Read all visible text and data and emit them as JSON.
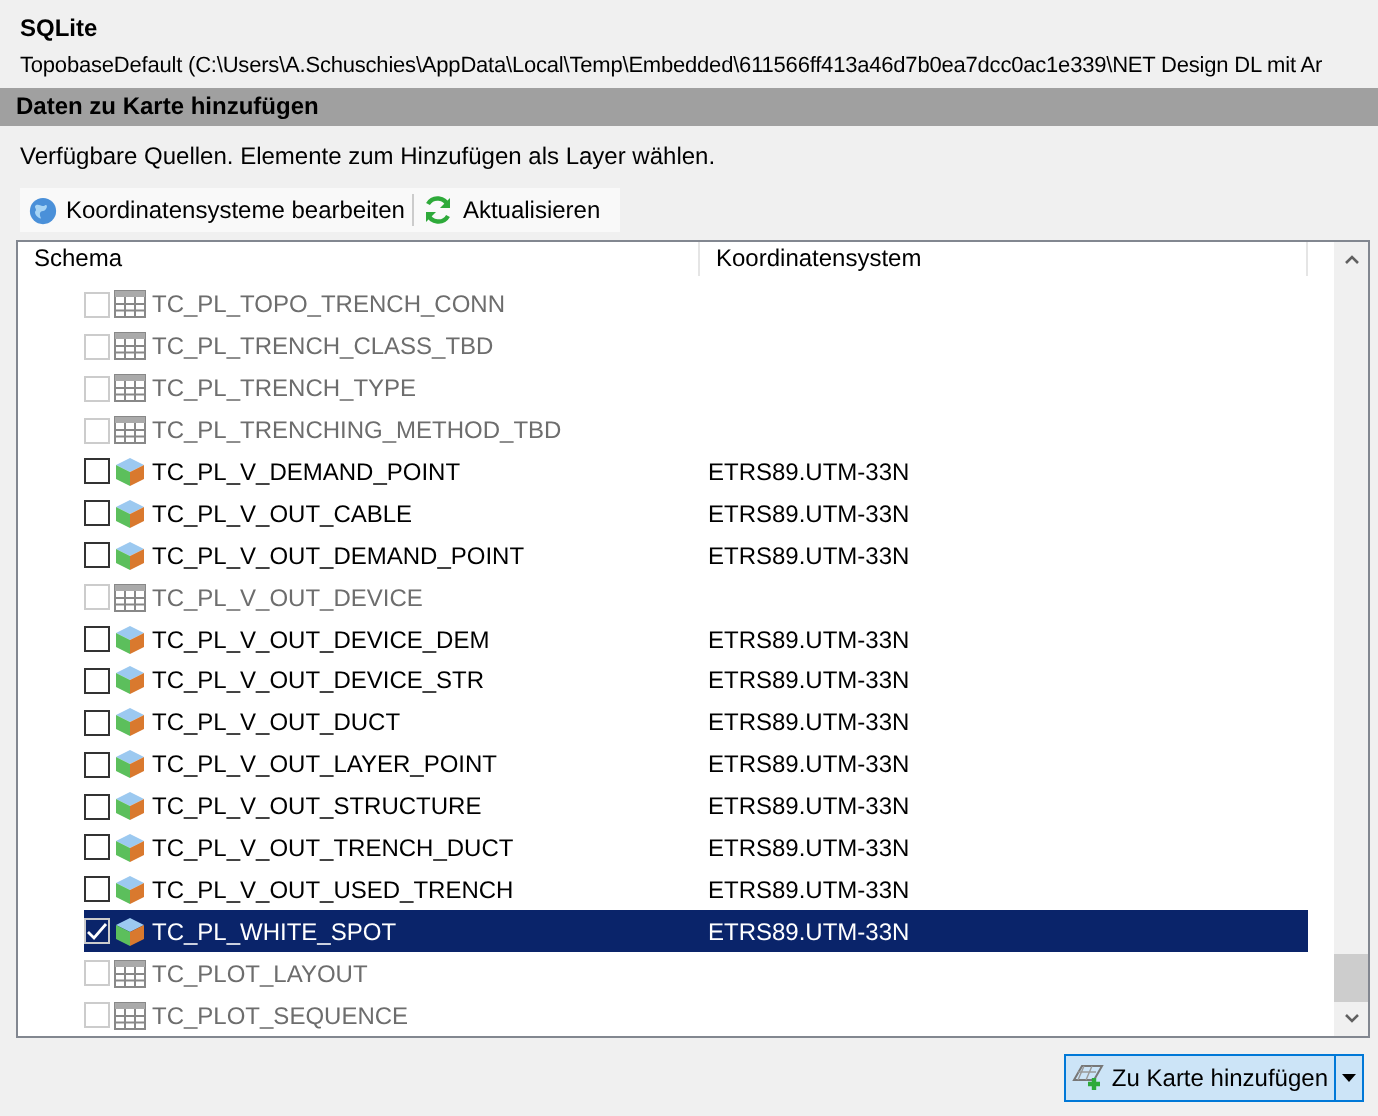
{
  "source": {
    "title": "SQLite",
    "path": "TopobaseDefault (C:\\Users\\A.Schuschies\\AppData\\Local\\Temp\\Embedded\\611566ff413a46d7b0ea7dcc0ac1e339\\NET Design DL mit Ar"
  },
  "section": {
    "title": "Daten zu Karte hinzufügen",
    "description": "Verfügbare Quellen. Elemente zum Hinzufügen als Layer wählen."
  },
  "toolbar": [
    {
      "label": "Koordinatensysteme bearbeiten",
      "kind": "globe"
    },
    {
      "label": "Aktualisieren",
      "kind": "refresh"
    }
  ],
  "table": {
    "columns": [
      "Schema",
      "Koordinatensystem"
    ],
    "rows": [
      {
        "name": "TC_PL_TOPO_TRENCH_CONN",
        "kind": "table",
        "disabled": true,
        "checked": false,
        "selected": false
      },
      {
        "name": "TC_PL_TRENCH_CLASS_TBD",
        "kind": "table",
        "disabled": true,
        "checked": false,
        "selected": false
      },
      {
        "name": "TC_PL_TRENCH_TYPE",
        "kind": "table",
        "disabled": true,
        "checked": false,
        "selected": false
      },
      {
        "name": "TC_PL_TRENCHING_METHOD_TBD",
        "kind": "table",
        "disabled": true,
        "checked": false,
        "selected": false
      },
      {
        "name": "TC_PL_V_DEMAND_POINT",
        "kind": "feature",
        "disabled": false,
        "checked": false,
        "selected": false,
        "crs": "ETRS89.UTM-33N"
      },
      {
        "name": "TC_PL_V_OUT_CABLE",
        "kind": "feature",
        "disabled": false,
        "checked": false,
        "selected": false,
        "crs": "ETRS89.UTM-33N"
      },
      {
        "name": "TC_PL_V_OUT_DEMAND_POINT",
        "kind": "feature",
        "disabled": false,
        "checked": false,
        "selected": false,
        "crs": "ETRS89.UTM-33N"
      },
      {
        "name": "TC_PL_V_OUT_DEVICE",
        "kind": "table",
        "disabled": true,
        "checked": false,
        "selected": false
      },
      {
        "name": "TC_PL_V_OUT_DEVICE_DEM",
        "kind": "feature",
        "disabled": false,
        "checked": false,
        "selected": false,
        "crs": "ETRS89.UTM-33N"
      },
      {
        "name": "TC_PL_V_OUT_DEVICE_STR",
        "kind": "feature",
        "disabled": false,
        "checked": false,
        "selected": false,
        "crs": "ETRS89.UTM-33N"
      },
      {
        "name": "TC_PL_V_OUT_DUCT",
        "kind": "feature",
        "disabled": false,
        "checked": false,
        "selected": false,
        "crs": "ETRS89.UTM-33N"
      },
      {
        "name": "TC_PL_V_OUT_LAYER_POINT",
        "kind": "feature",
        "disabled": false,
        "checked": false,
        "selected": false,
        "crs": "ETRS89.UTM-33N"
      },
      {
        "name": "TC_PL_V_OUT_STRUCTURE",
        "kind": "feature",
        "disabled": false,
        "checked": false,
        "selected": false,
        "crs": "ETRS89.UTM-33N"
      },
      {
        "name": "TC_PL_V_OUT_TRENCH_DUCT",
        "kind": "feature",
        "disabled": false,
        "checked": false,
        "selected": false,
        "crs": "ETRS89.UTM-33N"
      },
      {
        "name": "TC_PL_V_OUT_USED_TRENCH",
        "kind": "feature",
        "disabled": false,
        "checked": false,
        "selected": false,
        "crs": "ETRS89.UTM-33N"
      },
      {
        "name": "TC_PL_WHITE_SPOT",
        "kind": "feature",
        "disabled": false,
        "checked": true,
        "selected": true,
        "crs": "ETRS89.UTM-33N"
      },
      {
        "name": "TC_PLOT_LAYOUT",
        "kind": "table",
        "disabled": true,
        "checked": false,
        "selected": false
      },
      {
        "name": "TC_PLOT_SEQUENCE",
        "kind": "table",
        "disabled": true,
        "checked": false,
        "selected": false
      }
    ]
  },
  "add_button": {
    "label": "Zu Karte hinzufügen"
  }
}
